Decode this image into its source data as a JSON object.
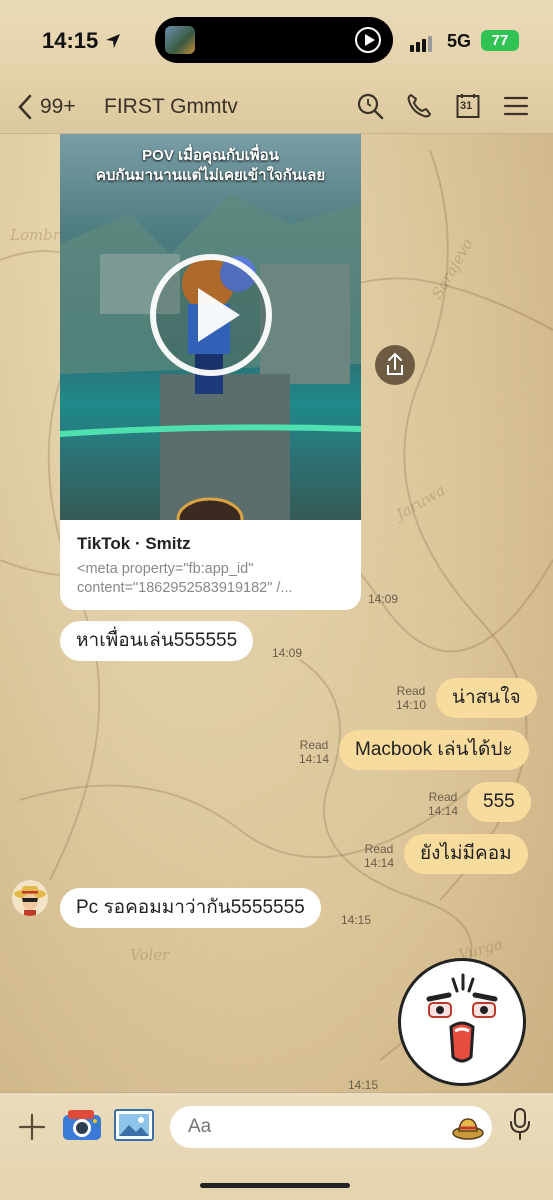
{
  "status_bar": {
    "time": "14:15",
    "network": "5G",
    "battery": "77"
  },
  "header": {
    "unread_count": "99+",
    "chat_name": "FIRST Gmmtv",
    "calendar_day": "31",
    "icons": [
      "search-icon",
      "phone-icon",
      "calendar-icon",
      "menu-icon"
    ]
  },
  "messages": {
    "video_card": {
      "caption_line1": "POV เมื่อคุณกับเพื่อน",
      "caption_line2": "คบกันมานานแต่ไม่เคยเข้าใจกันเลย",
      "title": "TikTok · Smitz",
      "desc": "<meta property=\"fb:app_id\" content=\"1862952583919182\" /...",
      "time": "14:09"
    },
    "m1": {
      "text": "หาเพื่อนเล่น555555",
      "time": "14:09"
    },
    "m2": {
      "text": "น่าสนใจ",
      "read": "Read",
      "time": "14:10"
    },
    "m3": {
      "text": "Macbook เล่นได้ปะ",
      "read": "Read",
      "time": "14:14"
    },
    "m4": {
      "text": "555",
      "read": "Read",
      "time": "14:14"
    },
    "m5": {
      "text": "ยังไม่มีคอม",
      "read": "Read",
      "time": "14:14"
    },
    "m6": {
      "text": "Pc รอคอมมาว่ากัน5555555",
      "time": "14:15"
    },
    "sticker_time": "14:15"
  },
  "input": {
    "placeholder": "Aa"
  },
  "colors": {
    "outgoing_bubble": "#f7dc9e",
    "incoming_bubble": "#ffffff",
    "battery": "#31c254"
  }
}
